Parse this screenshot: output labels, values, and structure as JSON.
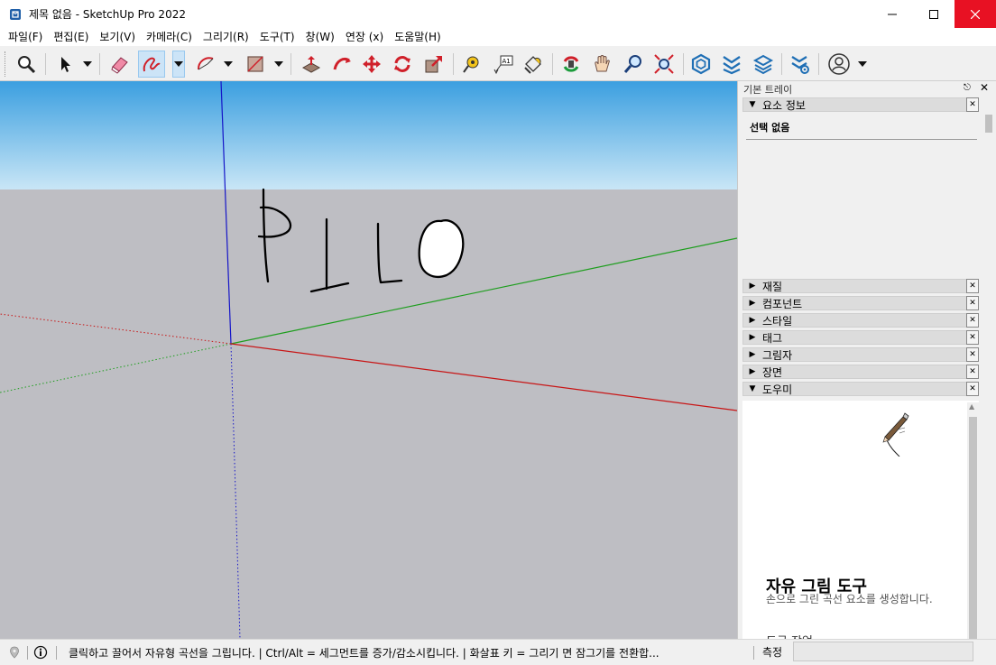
{
  "window": {
    "title": "제목 없음 - SketchUp Pro 2022",
    "minimize": "minimize-button",
    "maximize": "maximize-button",
    "close": "close-button"
  },
  "menu": [
    "파일(F)",
    "편집(E)",
    "보기(V)",
    "카메라(C)",
    "그리기(R)",
    "도구(T)",
    "창(W)",
    "연장 (x)",
    "도움말(H)"
  ],
  "toolbar": {
    "active_tool": "freehand-tool",
    "tools": [
      "search-icon",
      "select-icon",
      "eraser-icon",
      "freehand-icon",
      "arc-icon",
      "rectangle-icon",
      "push-pull-icon",
      "follow-me-icon",
      "move-icon",
      "rotate-icon",
      "scale-icon",
      "tape-measure-icon",
      "text-icon",
      "paint-bucket-icon",
      "orbit-icon",
      "pan-icon",
      "zoom-icon",
      "zoom-extents-icon",
      "warehouse-icon",
      "extension-warehouse-icon",
      "layout-icon",
      "extension-manager-icon",
      "account-icon"
    ]
  },
  "viewport": {
    "sky_top": "#3b9fe0",
    "sky_bottom": "#c9e6f6",
    "ground": "#bebec3",
    "drawn_text": "PILO"
  },
  "tray": {
    "title": "기본 트레이",
    "panels": [
      {
        "label": "요소 정보",
        "expanded": true
      },
      {
        "label": "재질",
        "expanded": false
      },
      {
        "label": "컴포넌트",
        "expanded": false
      },
      {
        "label": "스타일",
        "expanded": false
      },
      {
        "label": "태그",
        "expanded": false
      },
      {
        "label": "그림자",
        "expanded": false
      },
      {
        "label": "장면",
        "expanded": false
      },
      {
        "label": "도우미",
        "expanded": true
      }
    ],
    "entity_info": {
      "status": "선택 없음"
    },
    "instructor": {
      "title": "자유 그림 도구",
      "description": "손으로 그린 곡선 요소를 생성합니다.",
      "subheading": "도구 작업"
    }
  },
  "statusbar": {
    "message": "클릭하고 끌어서 자유형 곡선을 그립니다. | Ctrl/Alt = 세그먼트를 증가/감소시킵니다. | 화살표 키 = 그리기 면 잠그기를 전환합...",
    "measure_label": "측정",
    "measure_value": ""
  }
}
